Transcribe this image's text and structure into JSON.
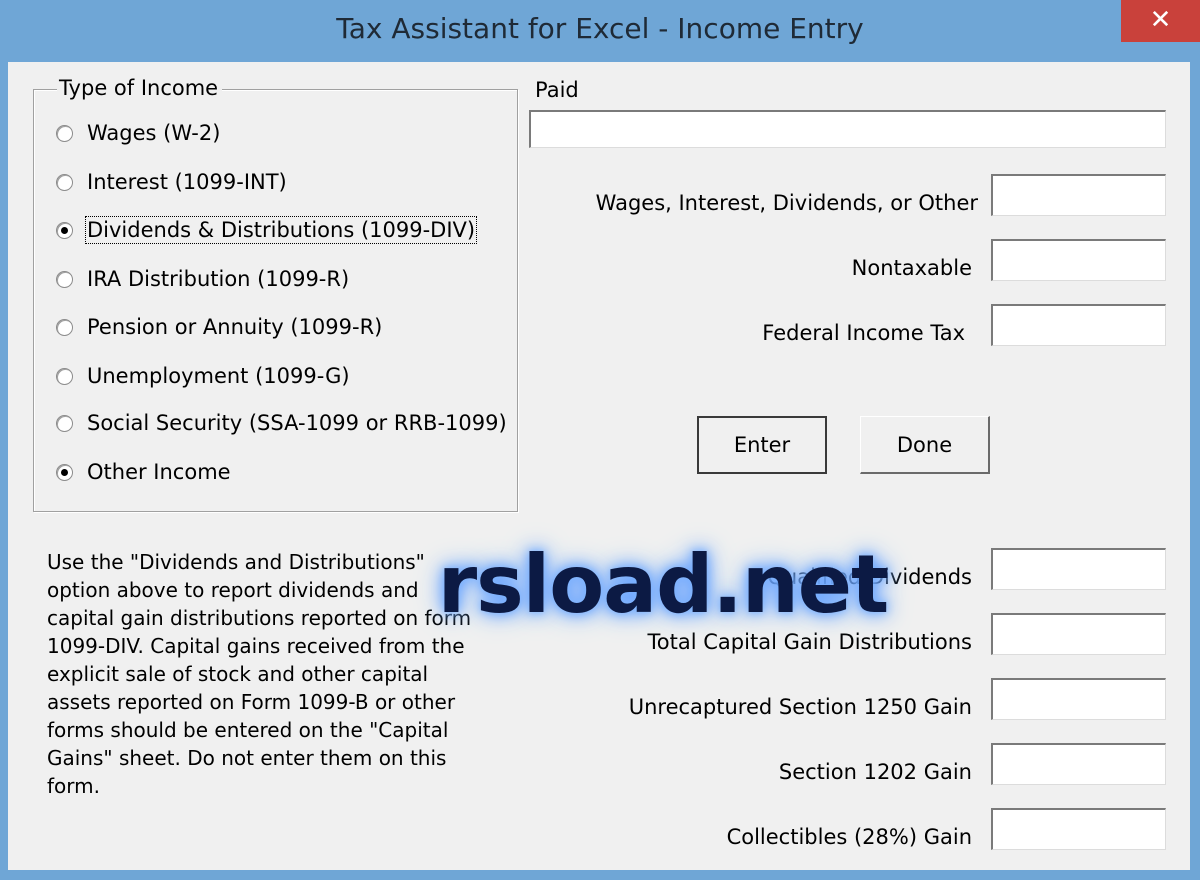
{
  "window": {
    "title": "Tax Assistant for Excel - Income Entry",
    "close_glyph": "✕"
  },
  "income_type": {
    "legend": "Type of Income",
    "options": [
      {
        "label": "Wages (W-2)",
        "selected": false
      },
      {
        "label": "Interest (1099-INT)",
        "selected": false
      },
      {
        "label": "Dividends & Distributions (1099-DIV)",
        "selected": true
      },
      {
        "label": "IRA Distribution (1099-R)",
        "selected": false
      },
      {
        "label": "Pension or Annuity (1099-R)",
        "selected": false
      },
      {
        "label": "Unemployment (1099-G)",
        "selected": false
      },
      {
        "label": "Social Security (SSA-1099 or RRB-1099)",
        "selected": false
      },
      {
        "label": "Other Income",
        "selected": true
      }
    ]
  },
  "paid": {
    "label": "Paid",
    "value": ""
  },
  "fields": {
    "wages": {
      "label": "Wages, Interest, Dividends, or Other",
      "value": ""
    },
    "nontaxable": {
      "label": "Nontaxable",
      "value": ""
    },
    "federal_tax": {
      "label": "Federal Income Tax",
      "value": ""
    },
    "qualified_dividends": {
      "label": "Qualified Dividends",
      "value": ""
    },
    "total_cap_gain": {
      "label": "Total Capital Gain Distributions",
      "value": ""
    },
    "unrecaptured_1250": {
      "label": "Unrecaptured Section 1250 Gain",
      "value": ""
    },
    "section_1202": {
      "label": "Section 1202 Gain",
      "value": ""
    },
    "collectibles": {
      "label": "Collectibles (28%) Gain",
      "value": ""
    }
  },
  "buttons": {
    "enter": "Enter",
    "done": "Done"
  },
  "help_text": "Use the \"Dividends and Distributions\" option above to report dividends and capital gain distributions reported on form 1099-DIV. Capital gains received from the explicit sale of stock and other capital assets reported on Form 1099-B or other forms should be entered on the \"Capital Gains\" sheet. Do not enter them on this form.",
  "watermark": "rsload.net"
}
